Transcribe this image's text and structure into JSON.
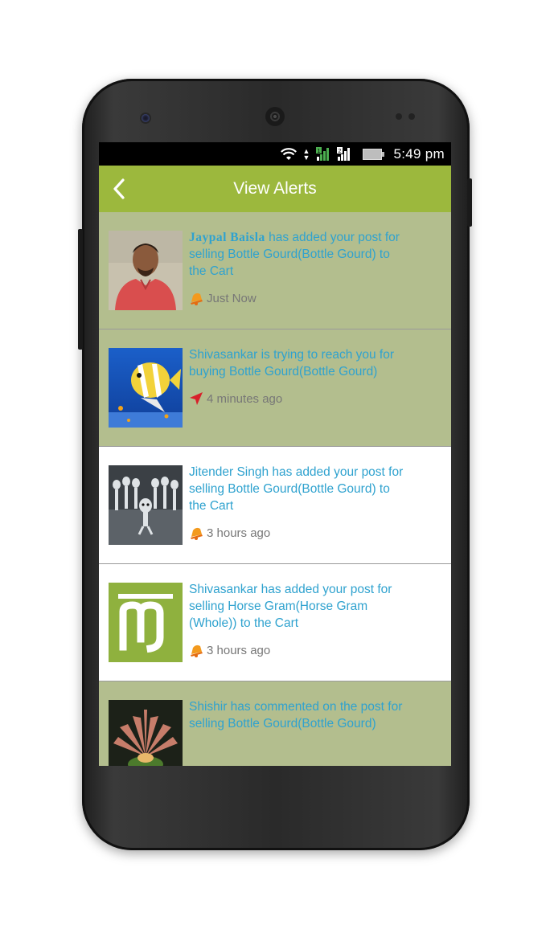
{
  "status": {
    "time": "5:49 pm"
  },
  "appbar": {
    "title": "View Alerts",
    "back_icon": "chevron-left-icon"
  },
  "alerts": [
    {
      "name": "Jaypal  Baisla",
      "message": " has added your post for selling Bottle Gourd(Bottle Gourd) to the Cart",
      "time": "Just Now",
      "icon": "bell-icon",
      "bg": "green",
      "thumb": "person-photo"
    },
    {
      "name": "",
      "message": "Shivasankar is trying to reach you for buying Bottle Gourd(Bottle Gourd)",
      "time": "4 minutes ago",
      "icon": "navigation-arrow-icon",
      "bg": "green",
      "thumb": "fish-photo"
    },
    {
      "name": "",
      "message": "Jitender Singh has added your post for selling Bottle Gourd(Bottle Gourd) to the Cart",
      "time": "3 hours ago",
      "icon": "bell-icon",
      "bg": "white",
      "thumb": "aliens-photo"
    },
    {
      "name": "",
      "message": "Shivasankar has added your post for selling Horse Gram(Horse Gram (Whole)) to the Cart",
      "time": "3 hours ago",
      "icon": "bell-icon",
      "bg": "white",
      "thumb": "logo-m"
    },
    {
      "name": "",
      "message": "Shishir has commented on the post for selling Bottle Gourd(Bottle Gourd)",
      "time": "",
      "icon": "bell-icon",
      "bg": "green",
      "thumb": "flower-photo"
    }
  ],
  "colors": {
    "appbar": "#9cb83d",
    "unread_bg": "#b3be8e",
    "read_bg": "#ffffff",
    "link_text": "#2fa2cf"
  }
}
